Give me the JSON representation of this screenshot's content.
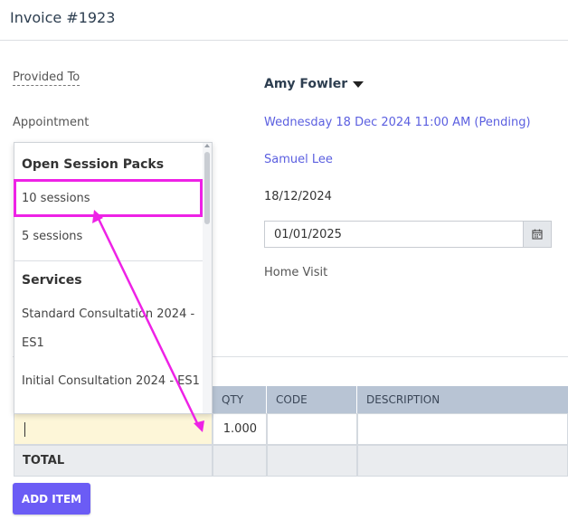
{
  "header": {
    "title": "Invoice #1923"
  },
  "form": {
    "provided_to_label": "Provided To",
    "client_name": "Amy Fowler",
    "appointment_label": "Appointment",
    "appointment_value": "Wednesday 18 Dec 2024 11:00 AM (Pending)",
    "practitioner": "Samuel Lee",
    "invoice_date": "18/12/2024",
    "due_date": "01/01/2025",
    "location": "Home Visit"
  },
  "dropdown": {
    "section1_title": "Open Session Packs",
    "section1_items": [
      "10 sessions",
      "5 sessions"
    ],
    "section2_title": "Services",
    "section2_items": [
      "Standard Consultation 2024 -",
      "ES1",
      "Initial Consultation 2024 - ES1"
    ]
  },
  "table": {
    "columns": [
      "QTY",
      "CODE",
      "DESCRIPTION"
    ],
    "row_qty": "1.000",
    "total_label": "TOTAL"
  },
  "actions": {
    "add_item_label": "ADD ITEM"
  },
  "annotation_color": "#ee22e6",
  "accent_color": "#6b5cf5"
}
